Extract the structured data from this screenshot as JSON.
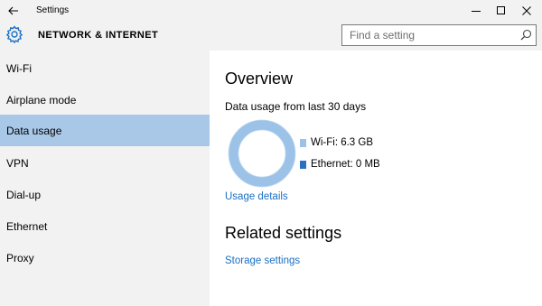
{
  "window": {
    "title": "Settings",
    "back_icon": "arrow-left-icon",
    "controls": [
      "minimize",
      "maximize",
      "close"
    ]
  },
  "header": {
    "section_title": "NETWORK & INTERNET",
    "icon": "gear-icon",
    "search_placeholder": "Find a setting"
  },
  "sidebar": {
    "items": [
      {
        "label": "Wi-Fi",
        "active": false
      },
      {
        "label": "Airplane mode",
        "active": false
      },
      {
        "label": "Data usage",
        "active": true
      },
      {
        "label": "VPN",
        "active": false
      },
      {
        "label": "Dial-up",
        "active": false
      },
      {
        "label": "Ethernet",
        "active": false
      },
      {
        "label": "Proxy",
        "active": false
      }
    ]
  },
  "main": {
    "overview_heading": "Overview",
    "usage_caption": "Data usage from last 30 days",
    "legend": [
      {
        "label": "Wi-Fi: 6.3 GB",
        "color": "#9cc3e7"
      },
      {
        "label": "Ethernet: 0 MB",
        "color": "#2a72c1"
      }
    ],
    "usage_details_link": "Usage details",
    "related_heading": "Related settings",
    "storage_settings_link": "Storage settings"
  },
  "colors": {
    "accent_link": "#1a6fc4",
    "selected_item": "#a9c8e8",
    "chrome_background": "#f2f2f2"
  }
}
